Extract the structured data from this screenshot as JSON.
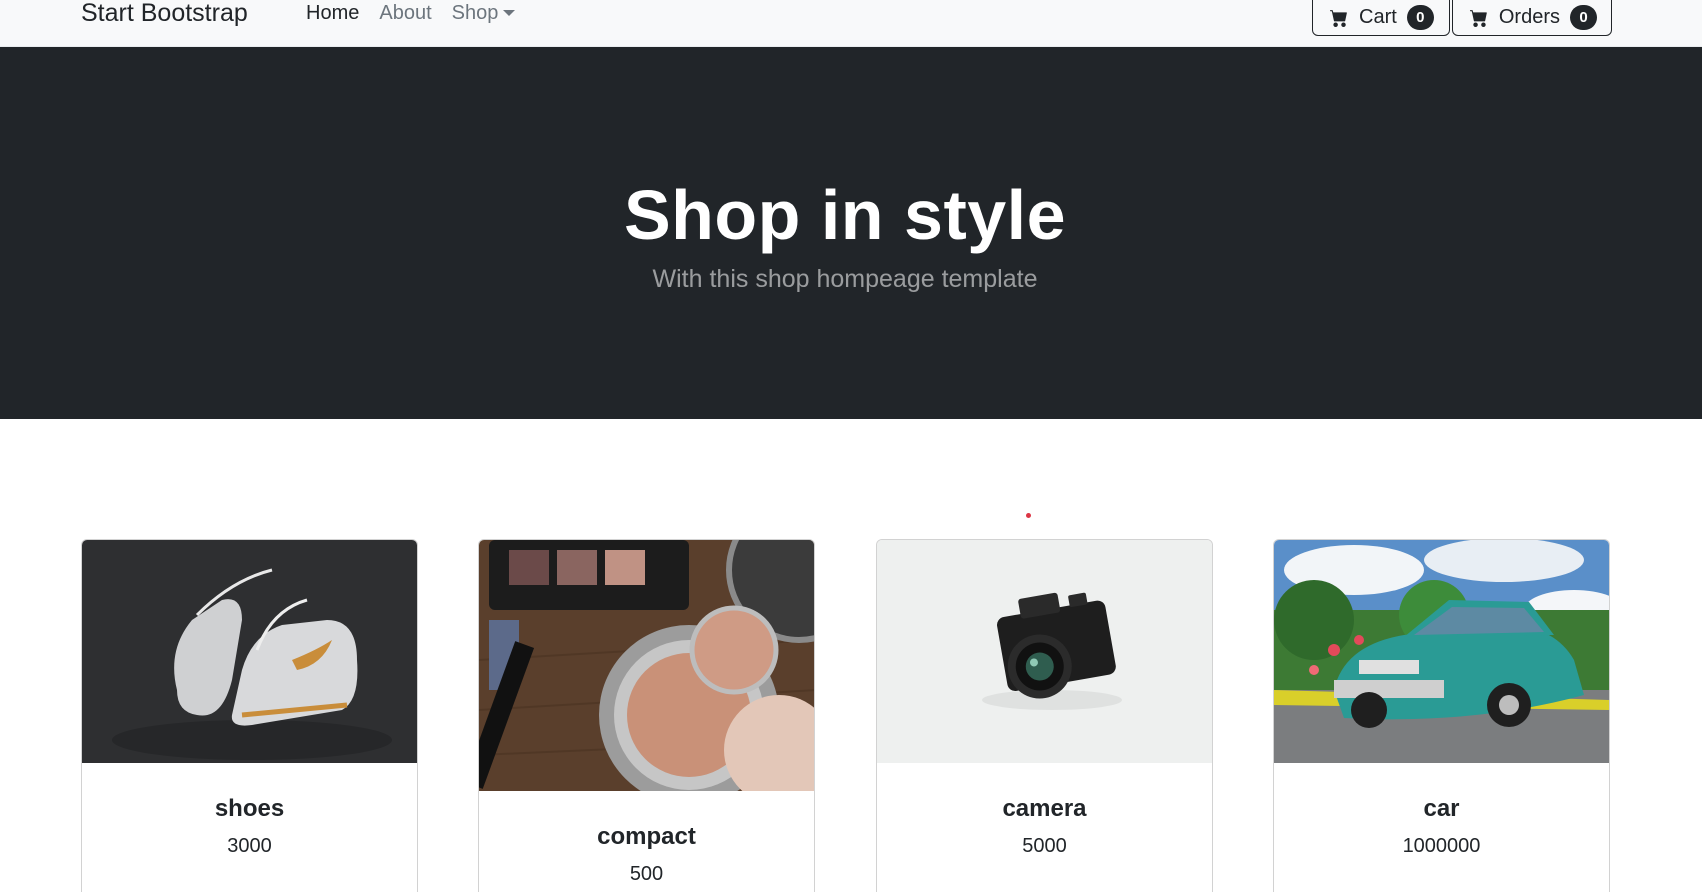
{
  "navbar": {
    "brand": "Start Bootstrap",
    "links": [
      {
        "label": "Home",
        "active": true
      },
      {
        "label": "About",
        "active": false
      },
      {
        "label": "Shop",
        "active": false,
        "dropdown": true
      }
    ],
    "cart": {
      "label": "Cart",
      "count": "0",
      "icon": "cart-icon"
    },
    "orders": {
      "label": "Orders",
      "count": "0",
      "icon": "cart-icon"
    }
  },
  "hero": {
    "title": "Shop in style",
    "subtitle": "With this shop hompeage template"
  },
  "products": [
    {
      "name": "shoes",
      "price": "3000"
    },
    {
      "name": "compact",
      "price": "500"
    },
    {
      "name": "camera",
      "price": "5000"
    },
    {
      "name": "car",
      "price": "1000000"
    }
  ],
  "colors": {
    "navbar_bg": "#f8f9fa",
    "hero_bg": "#212529",
    "accent": "#212529",
    "text_muted": "#6c757d"
  }
}
